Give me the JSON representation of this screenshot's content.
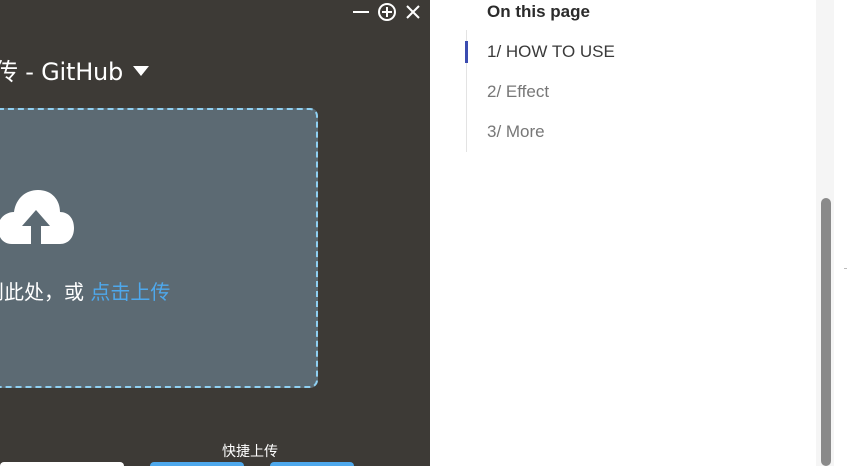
{
  "app": {
    "window_controls": {
      "minimize_icon": "minimize-icon",
      "zoom_icon": "zoom-in-circle-icon",
      "close_icon": "close-icon"
    },
    "title": "传 - GitHub",
    "title_caret_icon": "caret-down-icon",
    "dropzone": {
      "icon": "cloud-upload-icon",
      "text": "到此处，或",
      "link": "点击上传"
    },
    "quick_upload_label": "快捷上传"
  },
  "docs": {
    "toc_heading": "On this page",
    "toc_items": [
      {
        "label": "1/ HOW TO USE",
        "active": true
      },
      {
        "label": "2/ Effect",
        "active": false
      },
      {
        "label": "3/ More",
        "active": false
      }
    ]
  },
  "colors": {
    "app_bg": "#3d3a36",
    "dropzone_bg": "#5c6a73",
    "dropzone_border": "#8fd0f2",
    "link": "#4ea8ec",
    "toc_active_bar": "#3b4cb0"
  }
}
